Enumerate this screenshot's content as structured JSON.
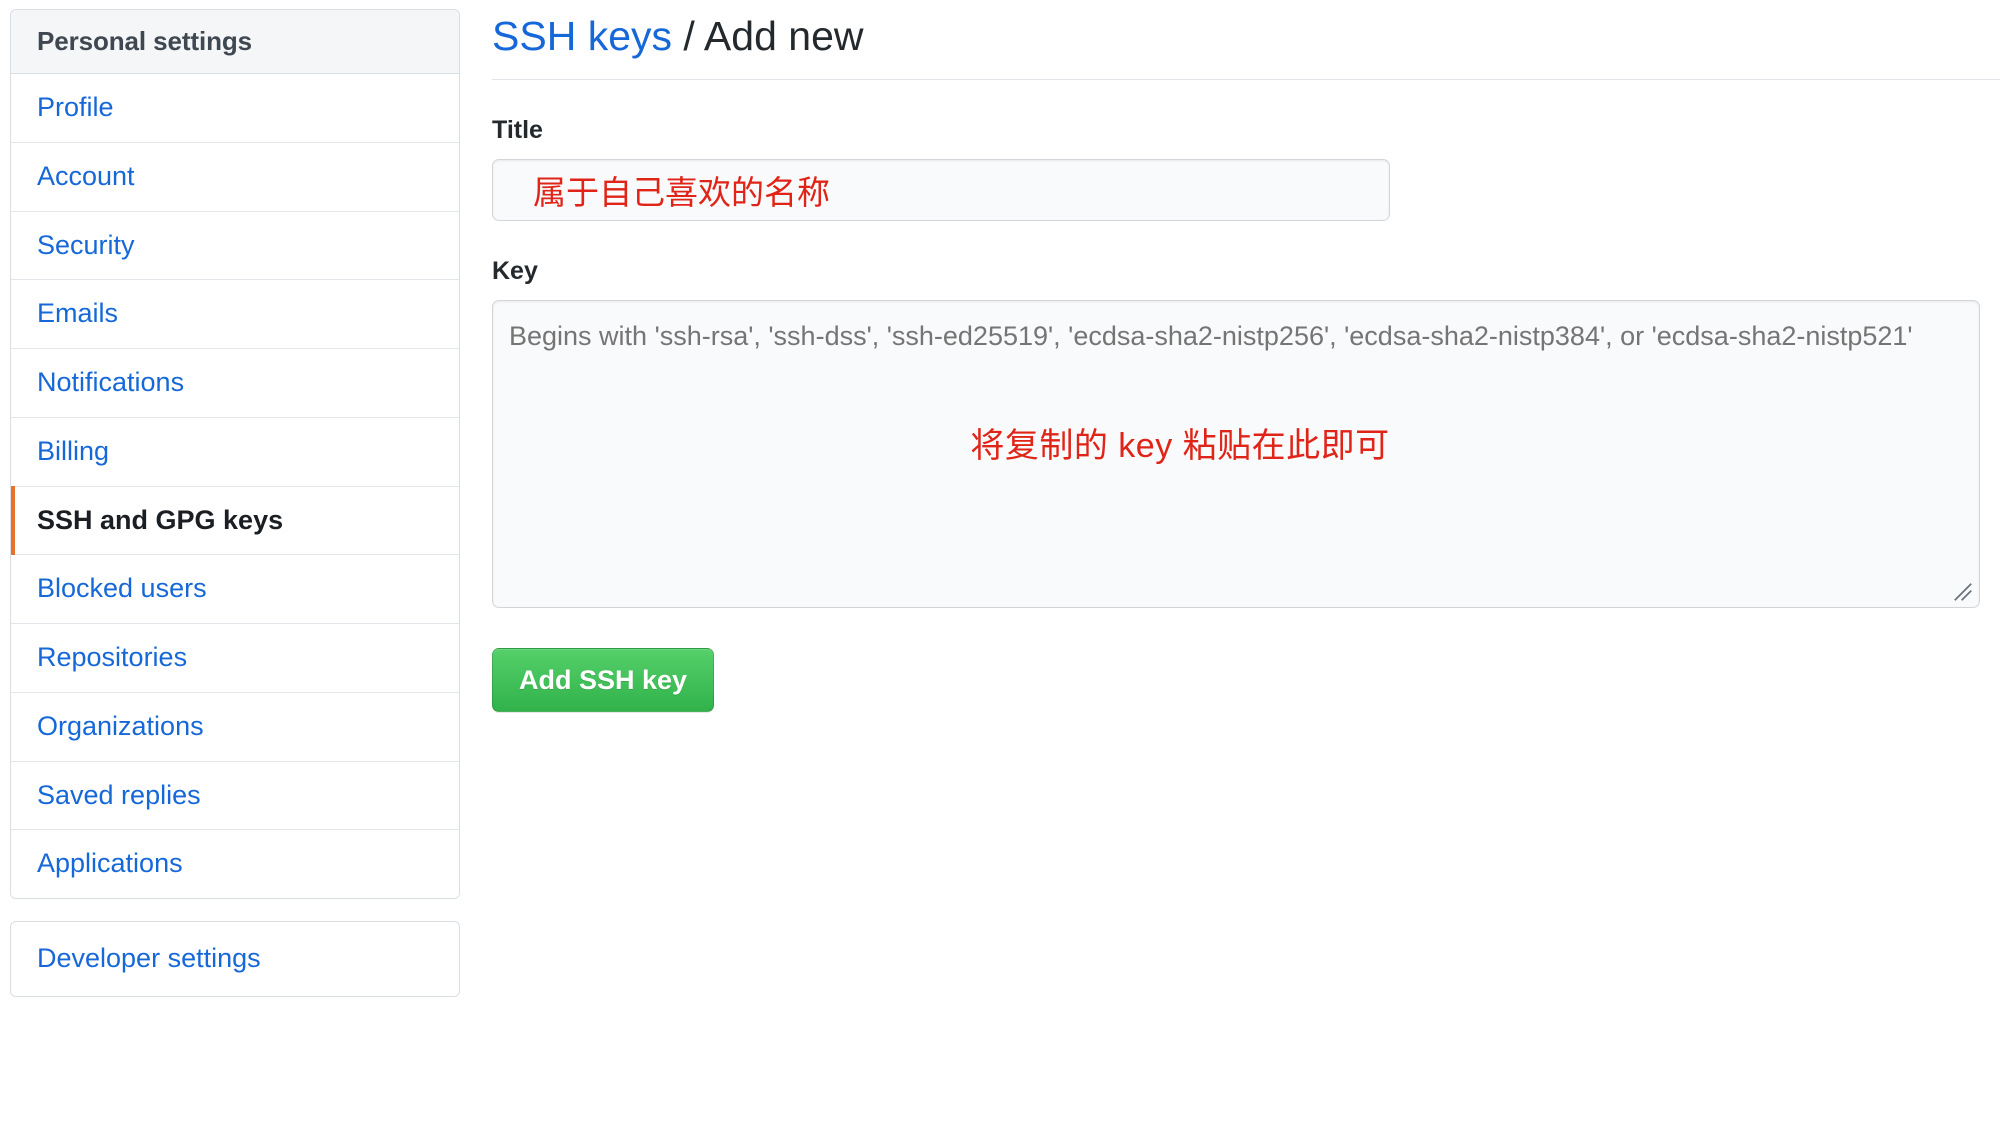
{
  "sidebar": {
    "header": "Personal settings",
    "items": [
      {
        "label": "Profile",
        "selected": false
      },
      {
        "label": "Account",
        "selected": false
      },
      {
        "label": "Security",
        "selected": false
      },
      {
        "label": "Emails",
        "selected": false
      },
      {
        "label": "Notifications",
        "selected": false
      },
      {
        "label": "Billing",
        "selected": false
      },
      {
        "label": "SSH and GPG keys",
        "selected": true
      },
      {
        "label": "Blocked users",
        "selected": false
      },
      {
        "label": "Repositories",
        "selected": false
      },
      {
        "label": "Organizations",
        "selected": false
      },
      {
        "label": "Saved replies",
        "selected": false
      },
      {
        "label": "Applications",
        "selected": false
      }
    ],
    "developer_settings": "Developer settings"
  },
  "main": {
    "breadcrumb_link": "SSH keys",
    "breadcrumb_separator": " / ",
    "breadcrumb_current": "Add new",
    "title_field": {
      "label": "Title",
      "value": "属于自己喜欢的名称",
      "placeholder": ""
    },
    "key_field": {
      "label": "Key",
      "value": "",
      "placeholder": "Begins with 'ssh-rsa', 'ssh-dss', 'ssh-ed25519', 'ecdsa-sha2-nistp256', 'ecdsa-sha2-nistp384', or 'ecdsa-sha2-nistp521'",
      "annotation": "将复制的 key 粘贴在此即可"
    },
    "submit_label": "Add SSH key"
  },
  "colors": {
    "link": "#1668d8",
    "accent_selected": "#e8712c",
    "annotation_red": "#e02418",
    "button_green": "#39b94d",
    "border": "#d8dee4",
    "header_bg": "#f4f6f8",
    "input_bg": "#f9fafb"
  }
}
